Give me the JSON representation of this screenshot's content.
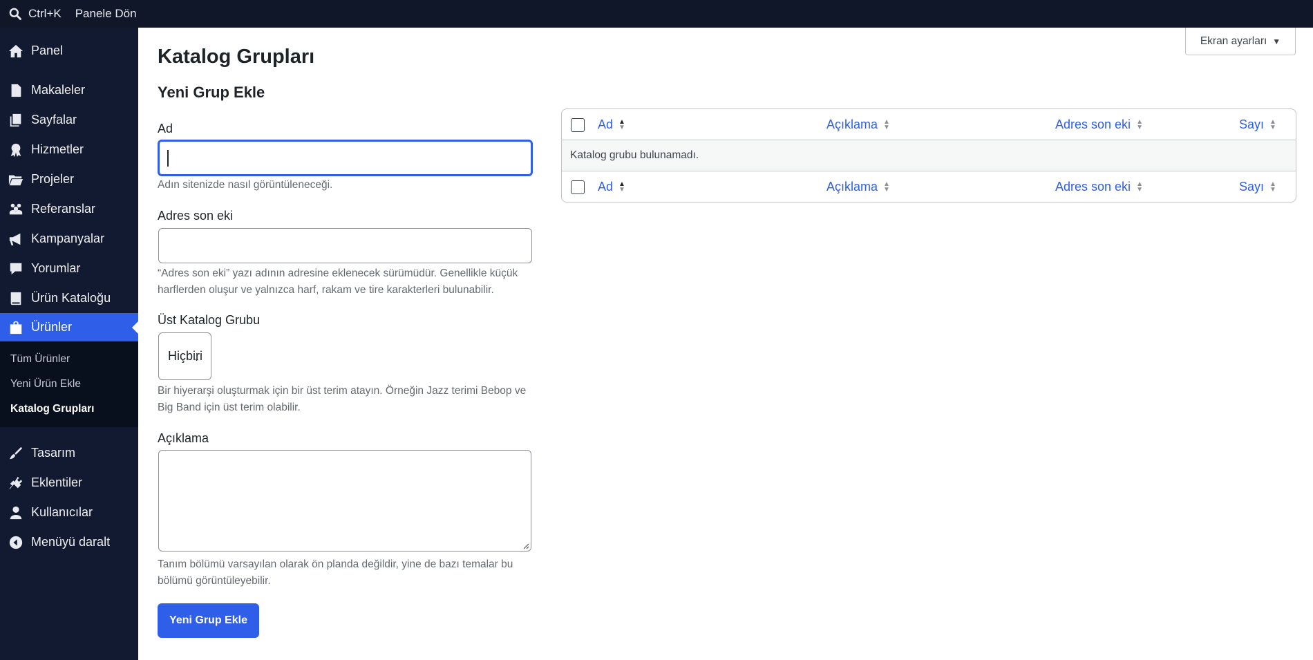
{
  "topbar": {
    "shortcut": "Ctrl+K",
    "back_link": "Panele Dön"
  },
  "sidebar": {
    "items": [
      {
        "label": "Panel",
        "icon": "home-icon"
      },
      {
        "label": "Makaleler",
        "icon": "document-icon"
      },
      {
        "label": "Sayfalar",
        "icon": "pages-icon"
      },
      {
        "label": "Hizmetler",
        "icon": "award-icon"
      },
      {
        "label": "Projeler",
        "icon": "folder-icon"
      },
      {
        "label": "Referanslar",
        "icon": "users-icon"
      },
      {
        "label": "Kampanyalar",
        "icon": "megaphone-icon"
      },
      {
        "label": "Yorumlar",
        "icon": "comment-icon"
      },
      {
        "label": "Ürün Kataloğu",
        "icon": "book-icon"
      },
      {
        "label": "Ürünler",
        "icon": "bag-icon",
        "active": true
      },
      {
        "label": "Tasarım",
        "icon": "brush-icon"
      },
      {
        "label": "Eklentiler",
        "icon": "plugin-icon"
      },
      {
        "label": "Kullanıcılar",
        "icon": "user-icon"
      },
      {
        "label": "Menüyü daralt",
        "icon": "collapse-icon"
      }
    ],
    "submenu": [
      {
        "label": "Tüm Ürünler"
      },
      {
        "label": "Yeni Ürün Ekle"
      },
      {
        "label": "Katalog Grupları",
        "current": true
      }
    ]
  },
  "header": {
    "screen_options": "Ekran ayarları",
    "page_title": "Katalog Grupları"
  },
  "form": {
    "title": "Yeni Grup Ekle",
    "name_label": "Ad",
    "name_value": "",
    "name_help": "Adın sitenizde nasıl görüntüleneceği.",
    "slug_label": "Adres son eki",
    "slug_value": "",
    "slug_help": "“Adres son eki” yazı adının adresine eklenecek sürümüdür. Genellikle küçük harflerden oluşur ve yalnızca harf, rakam ve tire karakterleri bulunabilir.",
    "parent_label": "Üst Katalog Grubu",
    "parent_selected": "Hiçbiri",
    "parent_help": "Bir hiyerarşi oluşturmak için bir üst terim atayın. Örneğin Jazz terimi Bebop ve Big Band için üst terim olabilir.",
    "description_label": "Açıklama",
    "description_value": "",
    "description_help": "Tanım bölümü varsayılan olarak ön planda değildir, yine de bazı temalar bu bölümü görüntüleyebilir.",
    "submit_label": "Yeni Grup Ekle"
  },
  "table": {
    "columns": [
      "Ad",
      "Açıklama",
      "Adres son eki",
      "Sayı"
    ],
    "empty_message": "Katalog grubu bulunamadı."
  },
  "colors": {
    "accent": "#2f5ee8",
    "sidebar_bg": "#111a30",
    "topbar_bg": "#0f1729"
  }
}
